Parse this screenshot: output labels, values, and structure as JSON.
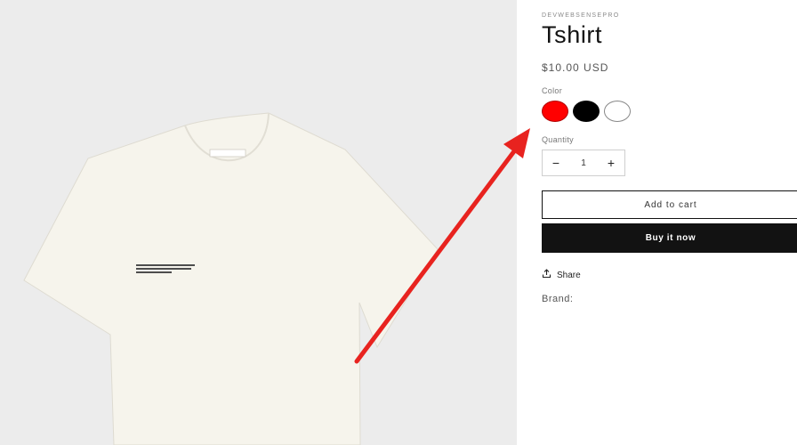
{
  "product": {
    "vendor": "DEVWEBSENSEPRO",
    "title": "Tshirt",
    "price": "$10.00 USD",
    "color_label": "Color",
    "colors": [
      {
        "name": "red",
        "hex": "#ff0000"
      },
      {
        "name": "black",
        "hex": "#000000"
      },
      {
        "name": "white",
        "hex": "#ffffff"
      }
    ],
    "quantity_label": "Quantity",
    "quantity_value": "1",
    "minus_symbol": "−",
    "plus_symbol": "+",
    "add_to_cart_label": "Add to cart",
    "buy_now_label": "Buy it now",
    "share_label": "Share",
    "brand_label": "Brand:"
  },
  "annotation": {
    "arrow_color": "#e8231f"
  }
}
